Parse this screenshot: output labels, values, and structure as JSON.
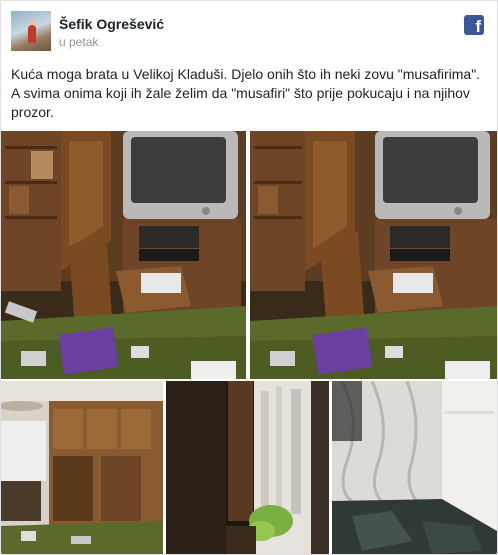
{
  "post": {
    "author": "Šefik Ogrešević",
    "timestamp": "u petak",
    "text": "Kuća moga brata u Velikoj Kladuši. Djelo onih što ih neki zovu \"musafirima\". A svima onima koji ih žale želim da \"musafiri\" što prije pokucaju i na njihov prozor.",
    "brand_icon": "facebook-icon",
    "brand_letter": "f"
  },
  "colors": {
    "facebook_blue": "#3b5998",
    "text": "#1d2129",
    "meta": "#90949c",
    "carpet": "#5a6a2a",
    "wood": "#7a4a22"
  }
}
